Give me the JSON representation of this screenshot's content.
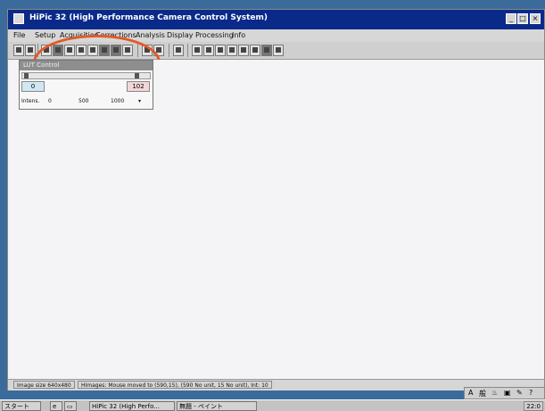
{
  "window": {
    "title": "HiPic 32 (High Performance Camera Control System)",
    "buttons": [
      "_",
      "□",
      "×"
    ]
  },
  "menu": [
    "File",
    "Setup",
    "Acquisition",
    "Corrections",
    "Analysis",
    "Display",
    "Processing",
    "Info"
  ],
  "lut_panel": {
    "title": "LUT Control",
    "low_value": "0",
    "high_value": "102",
    "scale_label": "Intens.",
    "scale_ticks": [
      "0",
      "500",
      "1000"
    ]
  },
  "status": {
    "image_size": "Image size 640x480",
    "message": "HImages: Mouse moved to (590,15), (590 No unit, 15 No unit), Int: 10"
  },
  "taskbar": {
    "start": "スタート",
    "tasks": [
      "HiPic 32 (High Perfo...",
      "無題 - ペイント"
    ],
    "clock": "22:0"
  },
  "colors": {
    "titlebar": "#0a2a8a",
    "annotation": "#e05a2a",
    "low_box": "#cfe8f2",
    "high_box": "#f3d7d7"
  }
}
